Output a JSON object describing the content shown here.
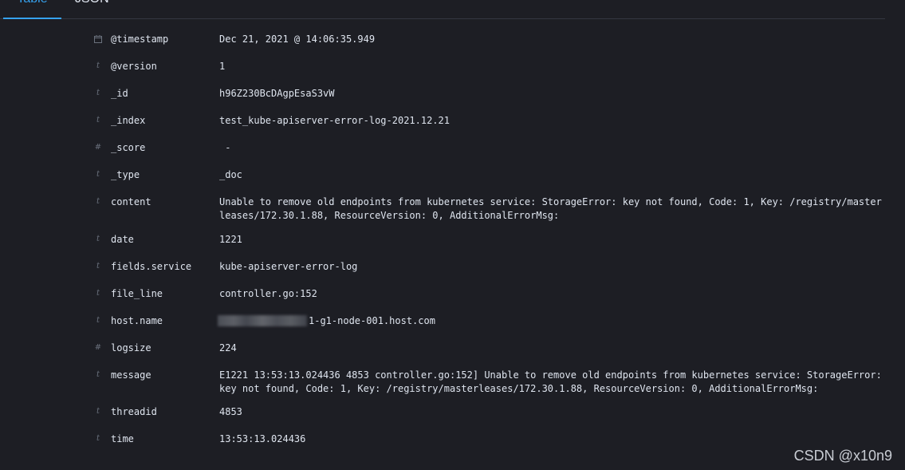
{
  "tabs": [
    {
      "label": "Table",
      "active": true
    },
    {
      "label": "JSON",
      "active": false
    }
  ],
  "fields": [
    {
      "type": "date",
      "name": "@timestamp",
      "value": "Dec 21, 2021 @ 14:06:35.949"
    },
    {
      "type": "string",
      "name": "@version",
      "value": "1"
    },
    {
      "type": "string",
      "name": "_id",
      "value": "h96Z230BcDAgpEsaS3vW"
    },
    {
      "type": "string",
      "name": "_index",
      "value": "test_kube-apiserver-error-log-2021.12.21"
    },
    {
      "type": "number",
      "name": "_score",
      "value": " -"
    },
    {
      "type": "string",
      "name": "_type",
      "value": "_doc"
    },
    {
      "type": "string",
      "name": "content",
      "value": "Unable to remove old endpoints from kubernetes service: StorageError: key not found, Code: 1, Key: /registry/masterleases/172.30.1.88, ResourceVersion: 0, AdditionalErrorMsg:"
    },
    {
      "type": "string",
      "name": "date",
      "value": "1221"
    },
    {
      "type": "string",
      "name": "fields.service",
      "value": "kube-apiserver-error-log"
    },
    {
      "type": "string",
      "name": "file_line",
      "value": "controller.go:152"
    },
    {
      "type": "string",
      "name": "host.name",
      "value": "1-g1-node-001.host.com",
      "redacted_prefix": true
    },
    {
      "type": "number",
      "name": "logsize",
      "value": "224"
    },
    {
      "type": "string",
      "name": "message",
      "value": "E1221 13:53:13.024436    4853 controller.go:152] Unable to remove old endpoints from kubernetes service: StorageError: key not found, Code: 1, Key: /registry/masterleases/172.30.1.88, ResourceVersion: 0, AdditionalErrorMsg:"
    },
    {
      "type": "string",
      "name": "threadid",
      "value": "4853"
    },
    {
      "type": "string",
      "name": "time",
      "value": "13:53:13.024436"
    }
  ],
  "watermark": "CSDN @x10n9",
  "colors": {
    "background": "#1d1e24",
    "text": "#dfe5ef",
    "accent": "#36a2ef",
    "type_icon": "#6a717d"
  },
  "icons": {
    "date": "calendar-icon",
    "string": "string-type-icon",
    "number": "number-type-icon"
  }
}
